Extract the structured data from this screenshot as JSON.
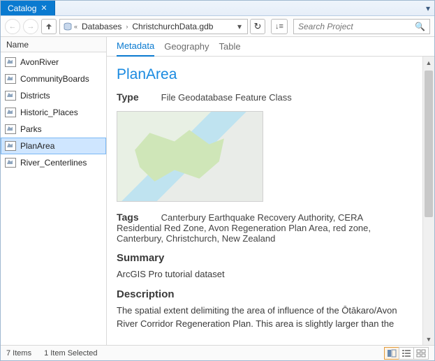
{
  "tab": {
    "title": "Catalog"
  },
  "breadcrumb": {
    "seg1": "Databases",
    "seg2": "ChristchurchData.gdb"
  },
  "search": {
    "placeholder": "Search Project"
  },
  "sidebar": {
    "header": "Name",
    "items": [
      {
        "label": "AvonRiver"
      },
      {
        "label": "CommunityBoards"
      },
      {
        "label": "Districts"
      },
      {
        "label": "Historic_Places"
      },
      {
        "label": "Parks"
      },
      {
        "label": "PlanArea",
        "selected": true
      },
      {
        "label": "River_Centerlines"
      }
    ]
  },
  "subtabs": {
    "t0": "Metadata",
    "t1": "Geography",
    "t2": "Table"
  },
  "metadata": {
    "title": "PlanArea",
    "type_label": "Type",
    "type_value": "File Geodatabase Feature Class",
    "tags_label": "Tags",
    "tags_value": "Canterbury Earthquake Recovery Authority, CERA Residential Red Zone, Avon Regeneration Plan Area, red zone, Canterbury, Christchurch, New Zealand",
    "summary_label": "Summary",
    "summary_value": "ArcGIS Pro tutorial dataset",
    "description_label": "Description",
    "description_value": "The spatial extent delimiting the area of influence of the Ōtākaro/Avon River Corridor Regeneration Plan. This area is slightly larger than the"
  },
  "statusbar": {
    "count": "7 Items",
    "selected": "1 Item Selected"
  }
}
